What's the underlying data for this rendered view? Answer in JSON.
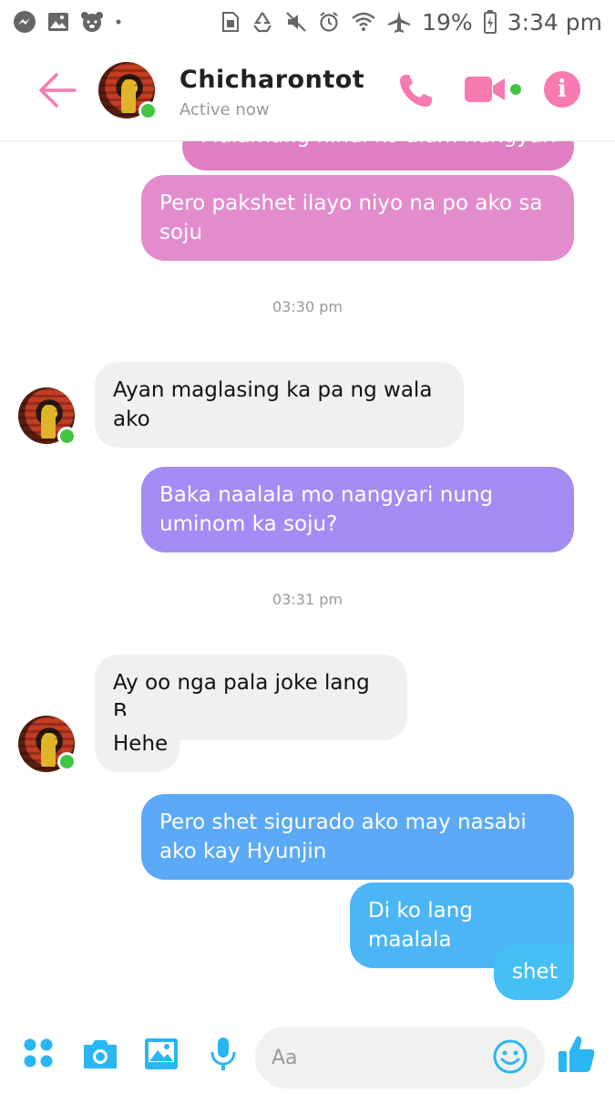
{
  "status_bar": {
    "battery_percent": "19%",
    "time": "3:34 pm",
    "left_icons": [
      "messenger-icon",
      "gallery-icon",
      "bear-icon",
      "dot-icon"
    ],
    "right_icons": [
      "sim-icon",
      "recycle-icon",
      "mute-icon",
      "alarm-icon",
      "wifi-icon",
      "airplane-icon",
      "battery-icon"
    ]
  },
  "header": {
    "contact_name": "Chicharontot",
    "status": "Active now",
    "icons": [
      "back-arrow-icon",
      "phone-icon",
      "video-icon",
      "info-icon"
    ],
    "accent_color": "#f77ab0",
    "info_glyph": "i"
  },
  "messages": [
    {
      "side": "outgoing",
      "text": "Malamang hindi ko alam nangyari",
      "color": "#e07fc4"
    },
    {
      "side": "outgoing",
      "text": "Pero pakshet ilayo niyo na po ako sa soju",
      "color": "#e28ccd"
    },
    {
      "type": "timestamp",
      "text": "03:30 pm"
    },
    {
      "side": "incoming",
      "text": "Ayan maglasing ka pa ng wala ako"
    },
    {
      "side": "outgoing",
      "text": "Baka naalala mo nangyari nung uminom ka soju?",
      "color": "#a38cf3"
    },
    {
      "type": "timestamp",
      "text": "03:31 pm"
    },
    {
      "side": "incoming",
      "text": "Ay oo nga pala joke lang B"
    },
    {
      "side": "incoming",
      "text": "Hehe"
    },
    {
      "side": "outgoing",
      "text": "Pero shet sigurado ako may nasabi ako kay Hyunjin",
      "color": "#5ba9f7"
    },
    {
      "side": "outgoing",
      "text": "Di ko lang maalala",
      "color": "#4bb5f5"
    },
    {
      "side": "outgoing",
      "text": "shet",
      "color": "#45bff4"
    }
  ],
  "composer": {
    "placeholder": "Aa",
    "icons": [
      "apps-icon",
      "camera-icon",
      "image-icon",
      "microphone-icon",
      "emoji-icon",
      "thumbs-up-icon"
    ],
    "accent_color": "#2ab6f2"
  }
}
